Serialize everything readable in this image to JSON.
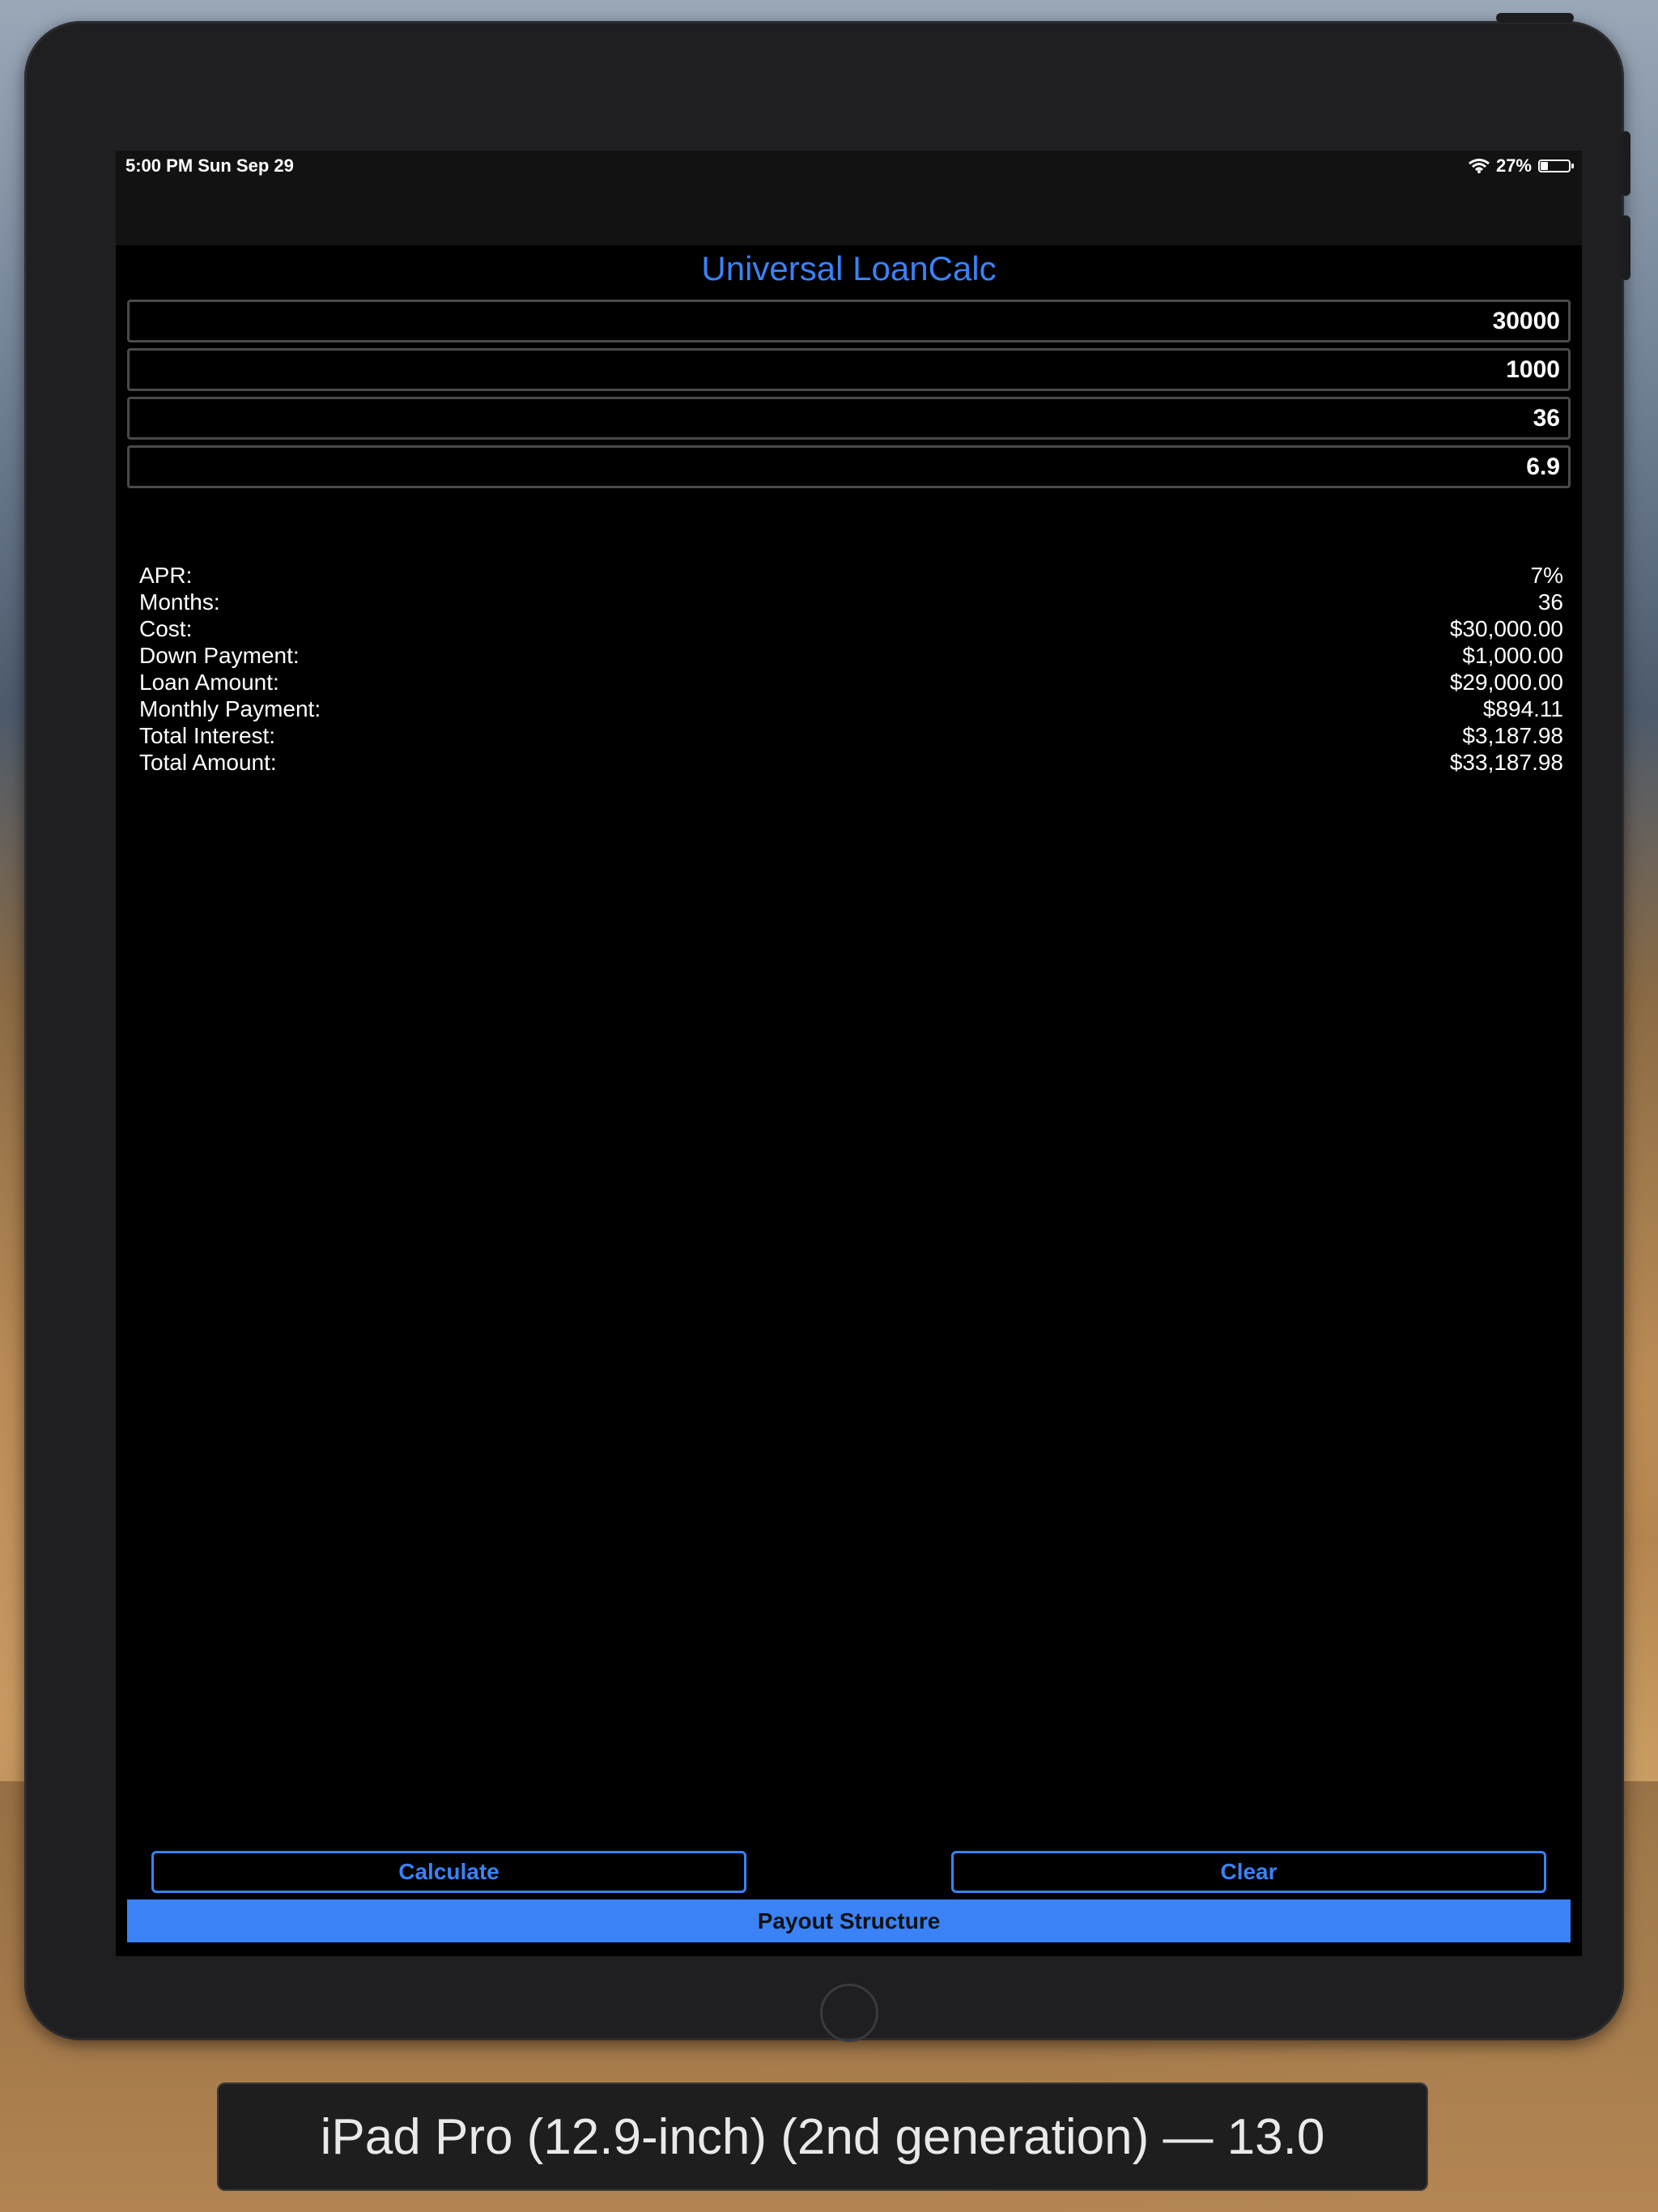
{
  "status_bar": {
    "time": "5:00 PM   Sun Sep 29",
    "battery_text": "27%",
    "battery_level": 0.27
  },
  "app": {
    "title": "Universal LoanCalc",
    "accent_color": "#3a82f7"
  },
  "inputs": [
    {
      "value": "30000"
    },
    {
      "value": "1000"
    },
    {
      "value": "36"
    },
    {
      "value": "6.9"
    }
  ],
  "results": [
    {
      "label": "APR:",
      "value": "7%"
    },
    {
      "label": "Months:",
      "value": "36"
    },
    {
      "label": "Cost:",
      "value": "$30,000.00"
    },
    {
      "label": "Down Payment:",
      "value": "$1,000.00"
    },
    {
      "label": "Loan Amount:",
      "value": "$29,000.00"
    },
    {
      "label": "Monthly Payment:",
      "value": "$894.11"
    },
    {
      "label": "Total Interest:",
      "value": "$3,187.98"
    },
    {
      "label": "Total Amount:",
      "value": "$33,187.98"
    }
  ],
  "buttons": {
    "calculate": "Calculate",
    "clear": "Clear",
    "payout": "Payout Structure"
  },
  "device_label": "iPad Pro (12.9-inch) (2nd generation) — 13.0"
}
